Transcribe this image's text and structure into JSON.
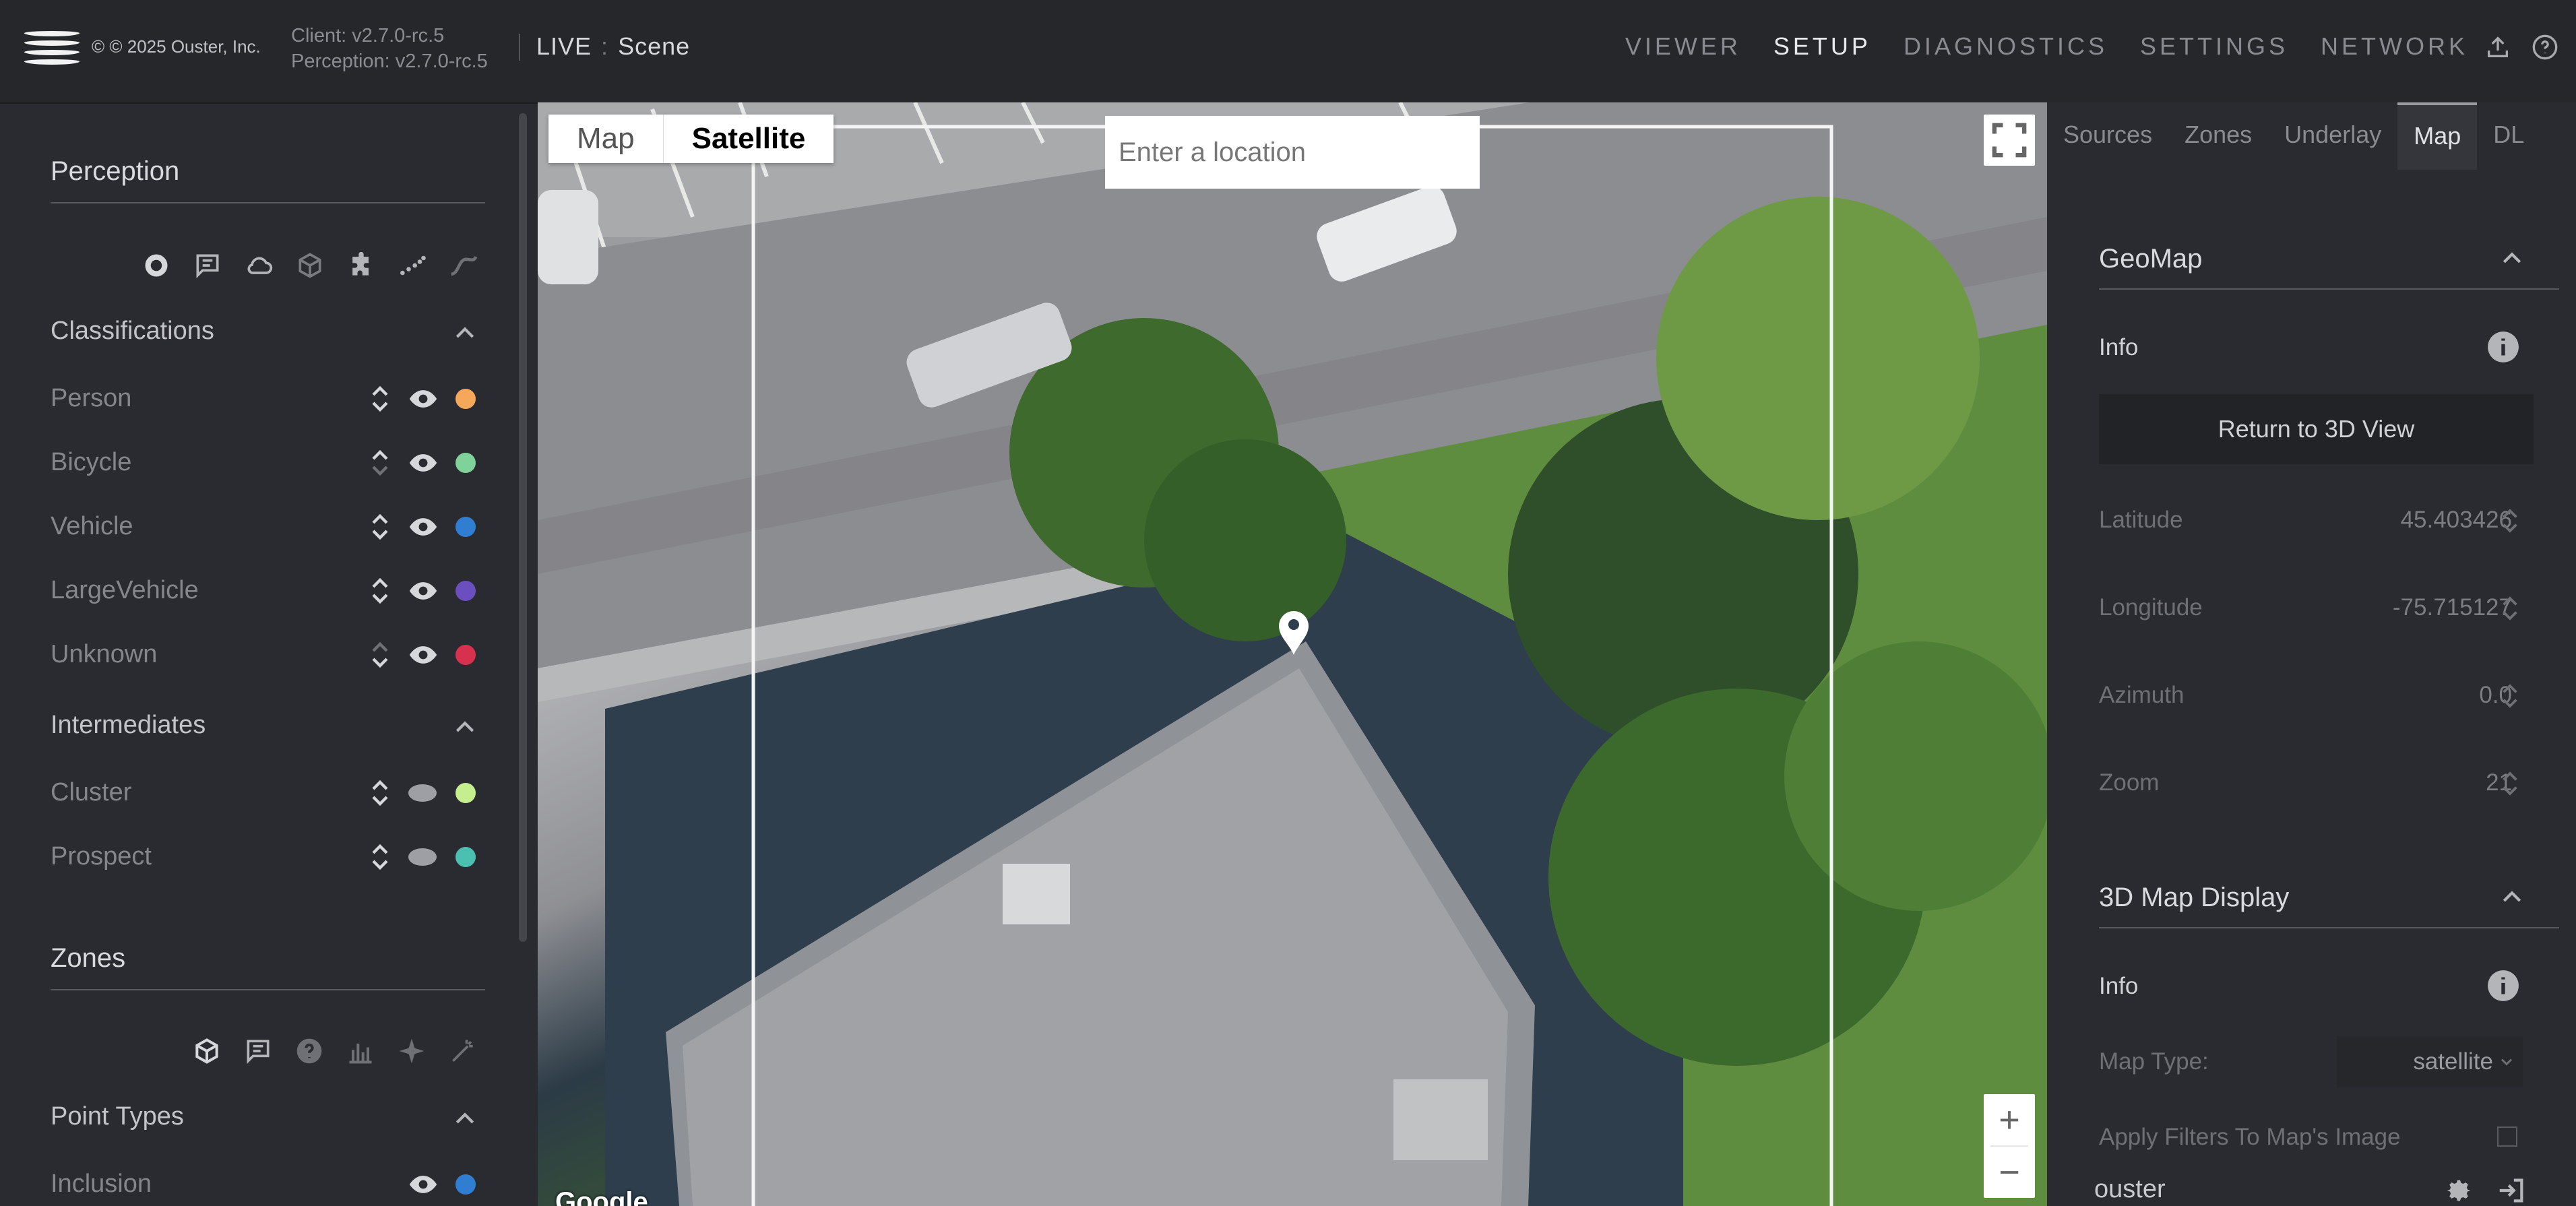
{
  "header": {
    "copyright": "© © 2025 Ouster, Inc.",
    "client_version": "Client: v2.7.0-rc.5",
    "perception_version": "Perception: v2.7.0-rc.5",
    "mode": "LIVE",
    "context": "Scene",
    "nav": [
      "VIEWER",
      "SETUP",
      "DIAGNOSTICS",
      "SETTINGS",
      "NETWORK"
    ],
    "nav_active": "SETUP"
  },
  "left_panel": {
    "perception_title": "Perception",
    "perception_icons": [
      "record-icon",
      "comment-icon",
      "cloud-icon",
      "cube-icon",
      "puzzle-icon",
      "trail-dots-icon",
      "curve-icon"
    ],
    "classifications_title": "Classifications",
    "classifications": [
      {
        "label": "Person",
        "color": "#f5a85a"
      },
      {
        "label": "Bicycle",
        "color": "#7fd39a"
      },
      {
        "label": "Vehicle",
        "color": "#2f7ed1"
      },
      {
        "label": "LargeVehicle",
        "color": "#6b4fbf"
      },
      {
        "label": "Unknown",
        "color": "#d8304f"
      }
    ],
    "intermediates_title": "Intermediates",
    "intermediates": [
      {
        "label": "Cluster",
        "color": "#c5ee8e"
      },
      {
        "label": "Prospect",
        "color": "#4cc0b0"
      }
    ],
    "zones_title": "Zones",
    "zone_icons": [
      "cube-outline-icon",
      "comment-icon",
      "help-circle-icon",
      "bar-chart-icon",
      "sparkle-icon",
      "magic-wand-icon"
    ],
    "point_types_title": "Point Types",
    "point_types": [
      {
        "label": "Inclusion",
        "color": "#2f7ed1"
      }
    ]
  },
  "map": {
    "toggle": [
      "Map",
      "Satellite"
    ],
    "toggle_active": "Satellite",
    "search_placeholder": "Enter a location",
    "attribution": "Google",
    "zoom_in": "+",
    "zoom_out": "−"
  },
  "right_panel": {
    "tabs": [
      "Sources",
      "Zones",
      "Underlay",
      "Map",
      "DL"
    ],
    "tab_active": "Map",
    "geomap_title": "GeoMap",
    "info_label": "Info",
    "return_button": "Return to 3D View",
    "fields": [
      {
        "label": "Latitude",
        "value": "45.403426"
      },
      {
        "label": "Longitude",
        "value": "-75.715127"
      },
      {
        "label": "Azimuth",
        "value": "0.0"
      },
      {
        "label": "Zoom",
        "value": "21"
      }
    ],
    "display_title": "3D Map Display",
    "display_info_label": "Info",
    "map_type_label": "Map Type:",
    "map_type_value": "satellite",
    "apply_filters_label": "Apply Filters To Map's Image",
    "footer_user": "ouster"
  }
}
